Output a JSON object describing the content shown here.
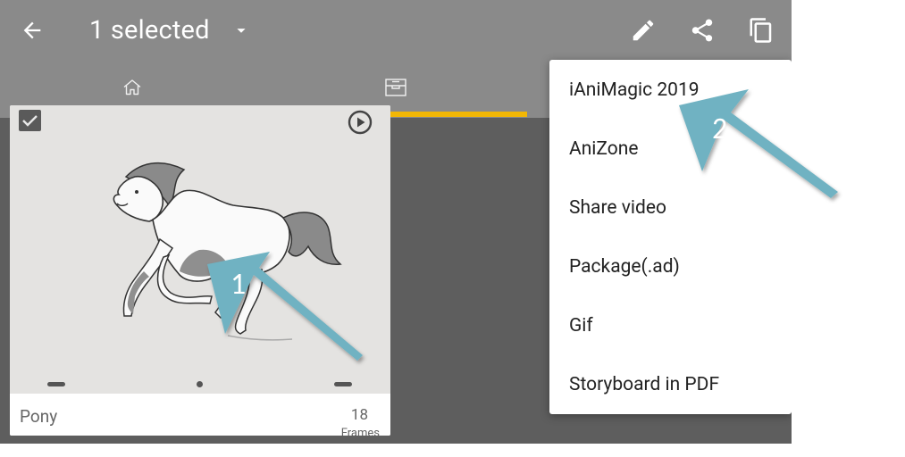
{
  "appbar": {
    "title": "1 selected",
    "back_icon": "arrow-left-icon",
    "dropdown_icon": "caret-down-icon",
    "actions": [
      "pencil-icon",
      "share-icon",
      "copy-icon"
    ]
  },
  "tabs": [
    {
      "icon": "home-icon",
      "active": false
    },
    {
      "icon": "inbox-icon",
      "active": true
    }
  ],
  "colors": {
    "appbar": "#8a8a8a",
    "background": "#5e5e5e",
    "tab_indicator": "#f2b705",
    "annotation": "#6fb2c2"
  },
  "project_card": {
    "name": "Pony",
    "frames_count": "18",
    "frames_label": "Frames",
    "selected": true
  },
  "menu": {
    "items": [
      "iAniMagic 2019",
      "AniZone",
      "Share video",
      "Package(.ad)",
      "Gif",
      "Storyboard in PDF"
    ]
  },
  "annotations": [
    "1",
    "2"
  ]
}
